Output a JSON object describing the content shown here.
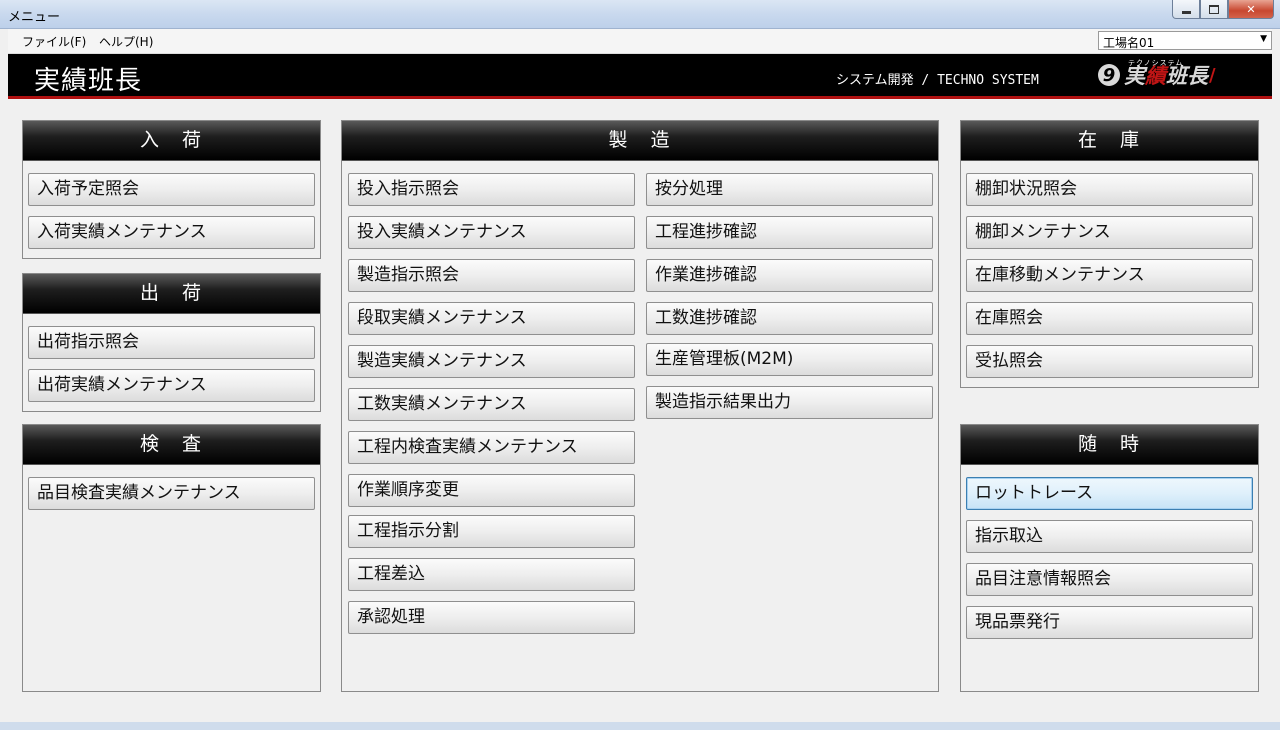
{
  "window": {
    "title": "メニュー"
  },
  "menubar": {
    "file": "ファイル(F)",
    "help": "ヘルプ(H)",
    "factory": "工場名01"
  },
  "banner": {
    "app_title": "実績班長",
    "company": "システム開発 / TECHNO SYSTEM",
    "logo_sup": "テクノシステム",
    "logo_text_a": "実",
    "logo_text_b": "績",
    "logo_text_c": "班長"
  },
  "sections": {
    "nyuka": {
      "title": "入　荷",
      "buttons": [
        "入荷予定照会",
        "入荷実績メンテナンス"
      ]
    },
    "shukka": {
      "title": "出　荷",
      "buttons": [
        "出荷指示照会",
        "出荷実績メンテナンス"
      ]
    },
    "kensa": {
      "title": "検　査",
      "buttons": [
        "品目検査実績メンテナンス"
      ]
    },
    "seizo": {
      "title": "製　造",
      "left_buttons": [
        "投入指示照会",
        "投入実績メンテナンス",
        "製造指示照会",
        "段取実績メンテナンス",
        "製造実績メンテナンス",
        "工数実績メンテナンス",
        "工程内検査実績メンテナンス",
        "作業順序変更",
        "工程指示分割",
        "工程差込",
        "承認処理"
      ],
      "right_buttons": [
        "按分処理",
        "工程進捗確認",
        "作業進捗確認",
        "工数進捗確認",
        "生産管理板(M2M)",
        "製造指示結果出力"
      ]
    },
    "zaiko": {
      "title": "在　庫",
      "buttons": [
        "棚卸状況照会",
        "棚卸メンテナンス",
        "在庫移動メンテナンス",
        "在庫照会",
        "受払照会"
      ]
    },
    "zuiji": {
      "title": "随　時",
      "buttons": [
        "ロットトレース",
        "指示取込",
        "品目注意情報照会",
        "現品票発行"
      ]
    }
  }
}
